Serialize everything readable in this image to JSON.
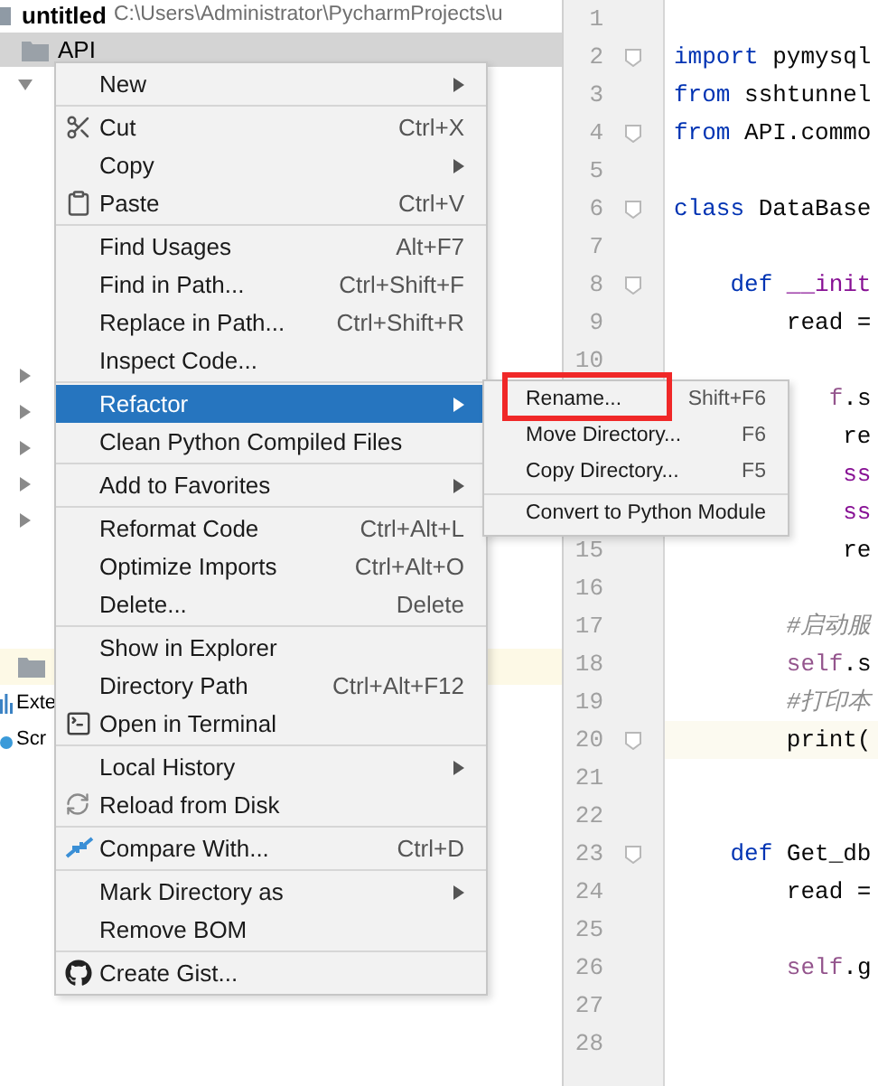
{
  "project": {
    "name": "untitled",
    "path": "C:\\Users\\Administrator\\PycharmProjects\\u",
    "root": {
      "label": "API",
      "selected": true
    },
    "rows": [
      {
        "expanded": true
      },
      {
        "expanded": false
      },
      {
        "expanded": false
      },
      {
        "expanded": false
      },
      {
        "expanded": false
      },
      {
        "expanded": false
      }
    ],
    "lower_rows": [
      {
        "kind": "folder",
        "highlighted": true
      },
      {
        "kind": "libraries",
        "label": "Exte",
        "highlighted": false
      },
      {
        "kind": "scratches",
        "label": "Scr",
        "highlighted": false
      }
    ]
  },
  "context_menu": [
    [
      {
        "label": "New",
        "submenu": true,
        "selected": false
      }
    ],
    [
      {
        "label": "Cut",
        "shortcut": "Ctrl+X",
        "submenu": false,
        "selected": false
      },
      {
        "label": "Copy",
        "submenu": true,
        "selected": false
      },
      {
        "label": "Paste",
        "shortcut": "Ctrl+V",
        "submenu": false,
        "selected": false
      }
    ],
    [
      {
        "label": "Find Usages",
        "shortcut": "Alt+F7",
        "submenu": false,
        "selected": false
      },
      {
        "label": "Find in Path...",
        "shortcut": "Ctrl+Shift+F",
        "submenu": false,
        "selected": false
      },
      {
        "label": "Replace in Path...",
        "shortcut": "Ctrl+Shift+R",
        "submenu": false,
        "selected": false
      },
      {
        "label": "Inspect Code...",
        "submenu": false,
        "selected": false
      }
    ],
    [
      {
        "label": "Refactor",
        "submenu": true,
        "selected": true
      },
      {
        "label": "Clean Python Compiled Files",
        "submenu": false,
        "selected": false
      }
    ],
    [
      {
        "label": "Add to Favorites",
        "submenu": true,
        "selected": false
      }
    ],
    [
      {
        "label": "Reformat Code",
        "shortcut": "Ctrl+Alt+L",
        "submenu": false,
        "selected": false
      },
      {
        "label": "Optimize Imports",
        "shortcut": "Ctrl+Alt+O",
        "submenu": false,
        "selected": false
      },
      {
        "label": "Delete...",
        "shortcut": "Delete",
        "submenu": false,
        "selected": false
      }
    ],
    [
      {
        "label": "Show in Explorer",
        "submenu": false,
        "selected": false
      },
      {
        "label": "Directory Path",
        "shortcut": "Ctrl+Alt+F12",
        "submenu": false,
        "selected": false
      },
      {
        "label": "Open in Terminal",
        "submenu": false,
        "selected": false
      }
    ],
    [
      {
        "label": "Local History",
        "submenu": true,
        "selected": false
      },
      {
        "label": "Reload from Disk",
        "submenu": false,
        "selected": false
      }
    ],
    [
      {
        "label": "Compare With...",
        "shortcut": "Ctrl+D",
        "submenu": false,
        "selected": false
      }
    ],
    [
      {
        "label": "Mark Directory as",
        "submenu": true,
        "selected": false
      },
      {
        "label": "Remove BOM",
        "submenu": false,
        "selected": false
      }
    ],
    [
      {
        "label": "Create Gist...",
        "submenu": false,
        "selected": false
      }
    ]
  ],
  "refactor_submenu": [
    [
      {
        "label": "Rename...",
        "shortcut": "Shift+F6",
        "highlighted": true
      },
      {
        "label": "Move Directory...",
        "shortcut": "F6",
        "highlighted": false
      },
      {
        "label": "Copy Directory...",
        "shortcut": "F5",
        "highlighted": false
      }
    ],
    [
      {
        "label": "Convert to Python Module",
        "highlighted": false
      }
    ]
  ],
  "editor_lines": [
    {
      "number": "1",
      "fold": false,
      "current": false
    },
    {
      "number": "2",
      "fold": true,
      "current": false,
      "tokens": [
        {
          "kind": "keyword",
          "text": "import"
        },
        {
          "kind": "plain",
          "text": " pymysql"
        }
      ]
    },
    {
      "number": "3",
      "fold": false,
      "current": false,
      "tokens": [
        {
          "kind": "keyword",
          "text": "from"
        },
        {
          "kind": "plain",
          "text": " sshtunnel"
        }
      ]
    },
    {
      "number": "4",
      "fold": true,
      "current": false,
      "tokens": [
        {
          "kind": "keyword",
          "text": "from"
        },
        {
          "kind": "plain",
          "text": " API.commo"
        }
      ]
    },
    {
      "number": "5",
      "fold": false,
      "current": false
    },
    {
      "number": "6",
      "fold": true,
      "current": false,
      "tokens": [
        {
          "kind": "keyword",
          "text": "class"
        },
        {
          "kind": "plain",
          "text": " DataBase"
        }
      ]
    },
    {
      "number": "7",
      "fold": false,
      "current": false
    },
    {
      "number": "8",
      "fold": true,
      "current": false,
      "tokens": [
        {
          "kind": "keyword",
          "text": "    def"
        },
        {
          "kind": "special",
          "text": " __init"
        }
      ]
    },
    {
      "number": "9",
      "fold": false,
      "current": false,
      "tokens": [
        {
          "kind": "plain",
          "text": "        read ="
        }
      ]
    },
    {
      "number": "10",
      "fold": false,
      "current": false
    },
    {
      "fold": false,
      "current": false,
      "tokens": [
        {
          "kind": "self",
          "text": "           f"
        },
        {
          "kind": "plain",
          "text": ".s"
        }
      ]
    },
    {
      "fold": false,
      "current": false,
      "tokens": [
        {
          "kind": "plain",
          "text": "            re"
        }
      ]
    },
    {
      "fold": false,
      "current": false,
      "tokens": [
        {
          "kind": "special",
          "text": "            ss"
        }
      ]
    },
    {
      "fold": false,
      "current": false,
      "tokens": [
        {
          "kind": "special",
          "text": "            ss"
        }
      ]
    },
    {
      "number": "15",
      "fold": false,
      "current": false,
      "tokens": [
        {
          "kind": "plain",
          "text": "            re"
        }
      ]
    },
    {
      "number": "16",
      "fold": false,
      "current": false
    },
    {
      "number": "17",
      "fold": false,
      "current": false,
      "tokens": [
        {
          "kind": "comment",
          "text": "        #启动服"
        }
      ]
    },
    {
      "number": "18",
      "fold": false,
      "current": false,
      "tokens": [
        {
          "kind": "self",
          "text": "        self"
        },
        {
          "kind": "plain",
          "text": ".s"
        }
      ]
    },
    {
      "number": "19",
      "fold": false,
      "current": false,
      "tokens": [
        {
          "kind": "comment",
          "text": "        #打印本"
        }
      ]
    },
    {
      "number": "20",
      "fold": true,
      "current": true,
      "tokens": [
        {
          "kind": "plain",
          "text": "        print("
        }
      ]
    },
    {
      "number": "21",
      "fold": false,
      "current": false
    },
    {
      "number": "22",
      "fold": false,
      "current": false
    },
    {
      "number": "23",
      "fold": true,
      "current": false,
      "tokens": [
        {
          "kind": "keyword",
          "text": "    def"
        },
        {
          "kind": "plain",
          "text": " Get_db"
        }
      ]
    },
    {
      "number": "24",
      "fold": false,
      "current": false,
      "tokens": [
        {
          "kind": "plain",
          "text": "        read ="
        }
      ]
    },
    {
      "number": "25",
      "fold": false,
      "current": false
    },
    {
      "number": "26",
      "fold": false,
      "current": false,
      "tokens": [
        {
          "kind": "self",
          "text": "        self"
        },
        {
          "kind": "plain",
          "text": ".g"
        }
      ]
    },
    {
      "number": "27",
      "fold": false,
      "current": false
    },
    {
      "number": "28",
      "fold": false,
      "current": false
    }
  ]
}
